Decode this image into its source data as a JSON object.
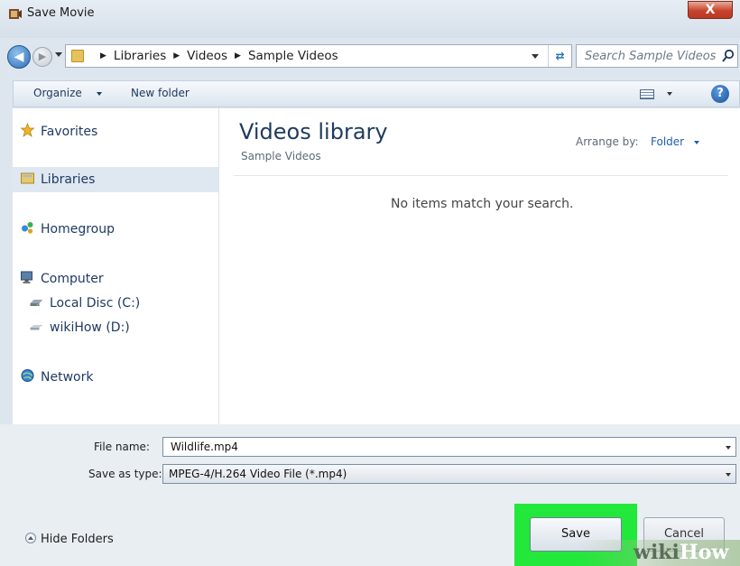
{
  "window": {
    "title": "Save Movie",
    "close_label": "X"
  },
  "address": {
    "crumbs": [
      "Libraries",
      "Videos",
      "Sample Videos"
    ],
    "search_placeholder": "Search Sample Videos"
  },
  "toolbar": {
    "organize_label": "Organize",
    "new_folder_label": "New folder",
    "help_label": "?"
  },
  "nav": {
    "favorites": "Favorites",
    "libraries": "Libraries",
    "homegroup": "Homegroup",
    "computer": "Computer",
    "local_disc": "Local Disc (C:)",
    "wikihow_drive": "wikiHow (D:)",
    "network": "Network"
  },
  "content": {
    "title": "Videos library",
    "subtitle": "Sample Videos",
    "arrange_label": "Arrange by:",
    "arrange_value": "Folder",
    "empty_message": "No items match your search."
  },
  "form": {
    "file_name_label": "File name:",
    "file_name_value": "Wildlife.mp4",
    "save_type_label": "Save as type:",
    "save_type_value": "MPEG-4/H.264 Video File (*.mp4)"
  },
  "footer": {
    "hide_folders_label": "Hide Folders",
    "save_label": "Save",
    "cancel_label": "Cancel"
  },
  "watermark": {
    "wiki": "wiki",
    "how": "How"
  },
  "colors": {
    "highlight": "#21e83a",
    "close_red": "#c7432b",
    "link_blue": "#1f5fb0"
  }
}
